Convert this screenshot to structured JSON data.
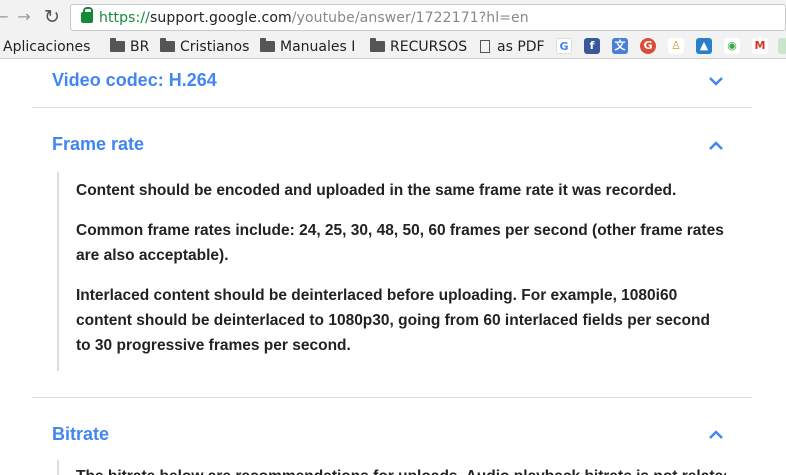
{
  "browser": {
    "url_scheme": "https://",
    "url_host": "support.google.com",
    "url_path": "/youtube/answer/1722171?hl=en"
  },
  "bookmarks": {
    "apps_label": "Aplicaciones",
    "folders": [
      "BR",
      "Cristianos",
      "Manuales I",
      "RECURSOS"
    ],
    "page_label": "as PDF"
  },
  "sections": {
    "codec_title": "Video codec: H.264",
    "frame_rate_title": "Frame rate",
    "bitrate_title": "Bitrate"
  },
  "frame_rate": {
    "p1": "Content should be encoded and uploaded in the same frame rate it was recorded.",
    "p2": "Common frame rates include: 24, 25, 30, 48, 50, 60 frames per second (other frame rates are also acceptable).",
    "p3": "Interlaced content should be deinterlaced before uploading. For example, 1080i60 content should be deinterlaced to 1080p30, going from 60 interlaced fields per second to 30 progressive frames per second.",
    "p_cut": "The bitrate below are recommendations for uploads. Audio playback bitrate is not related"
  },
  "colors": {
    "link_blue": "#4285f4",
    "secure_green": "#138a36"
  }
}
